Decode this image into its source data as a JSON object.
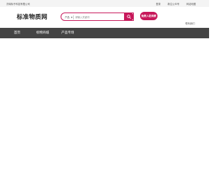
{
  "topbar": {
    "company": "济南标予科技有限公司",
    "links": [
      "登录",
      "新注公众号",
      "网站地图"
    ]
  },
  "header": {
    "logo_text": "标准物质网",
    "search": {
      "category": "产品",
      "placeholder": "请输入关键词"
    },
    "merchant_button": "免费入驻商家",
    "help_link": "联系我们"
  },
  "nav": {
    "items": [
      "首页",
      "标物商城",
      "产品专场"
    ]
  },
  "colors": {
    "accent": "#c7185a",
    "nav_bg": "#444444",
    "topbar_bg": "#f4f4f4"
  }
}
